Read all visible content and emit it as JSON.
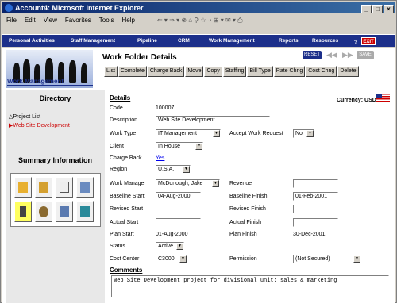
{
  "window": {
    "title": "Account4: Microsoft Internet Explorer"
  },
  "menu": [
    "File",
    "Edit",
    "View",
    "Favorites",
    "Tools",
    "Help"
  ],
  "app_nav": [
    "Personal Activities",
    "Staff Management",
    "Pipeline",
    "CRM",
    "Work Management",
    "Reports",
    "Resources"
  ],
  "app_nav_help": "?",
  "app_nav_exit": "EXIT",
  "header": {
    "banner_label": "Work Management",
    "page_title": "Work Folder Details",
    "reset_label": "RESET",
    "save_label": "SAVE",
    "actions": [
      "List",
      "Complete",
      "Charge Back",
      "Move",
      "Copy",
      "Staffing",
      "Bill Type",
      "Rate Chng",
      "Cost Chng",
      "Delete"
    ]
  },
  "left": {
    "directory_title": "Directory",
    "directory_items": [
      "Project List",
      "Web Site Development"
    ],
    "summary_title": "Summary Information",
    "summary_icons": [
      "alert-folder-icon",
      "folder-list-icon",
      "documents-icon",
      "tools-icon",
      "hourglass-icon",
      "money-bag-icon",
      "ledger-icon",
      "calculator-icon"
    ]
  },
  "form": {
    "details_heading": "Details",
    "currency_label": "Currency: USD",
    "code_label": "Code",
    "code_value": "100007",
    "description_label": "Description",
    "description_value": "Web Site Development",
    "work_type_label": "Work Type",
    "work_type_value": "IT Management",
    "accept_label": "Accept Work Request",
    "accept_value": "No",
    "client_label": "Client",
    "client_value": "In House",
    "charge_back_label": "Charge Back",
    "charge_back_value": "Yes",
    "region_label": "Region",
    "region_value": "U.S.A.",
    "work_manager_label": "Work Manager",
    "work_manager_value": "McDonough, Jake",
    "revenue_label": "Revenue",
    "revenue_value": "",
    "baseline_start_label": "Baseline Start",
    "baseline_start_value": "04-Aug-2000",
    "baseline_finish_label": "Baseline Finish",
    "baseline_finish_value": "01-Feb-2001",
    "revised_start_label": "Revised Start",
    "revised_start_value": "",
    "revised_finish_label": "Revised Finish",
    "revised_finish_value": "",
    "actual_start_label": "Actual Start",
    "actual_start_value": "",
    "actual_finish_label": "Actual Finish",
    "actual_finish_value": "",
    "plan_start_label": "Plan Start",
    "plan_start_value": "01-Aug-2000",
    "plan_finish_label": "Plan Finish",
    "plan_finish_value": "30-Dec-2001",
    "status_label": "Status",
    "status_value": "Active",
    "cost_center_label": "Cost Center",
    "cost_center_value": "C3000",
    "permission_label": "Permission",
    "permission_value": "(Not Secured)",
    "comments_heading": "Comments",
    "comments_value": "Web Site Development project for divisional unit: sales & marketing"
  }
}
